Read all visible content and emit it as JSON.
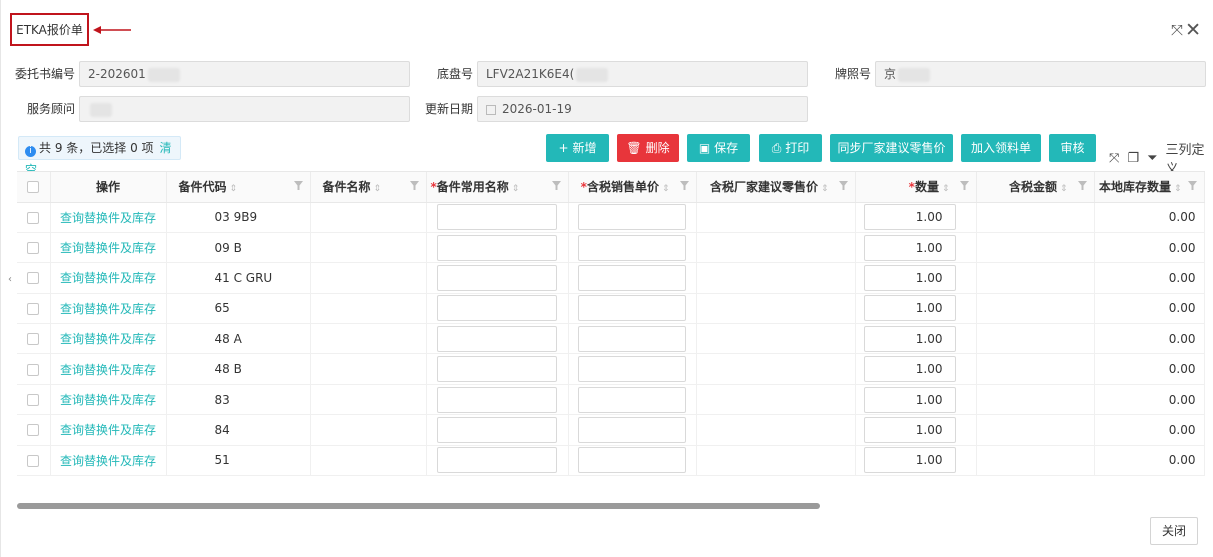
{
  "header": {
    "title": "ETKA报价单"
  },
  "form": {
    "entrust_no_label": "委托书编号",
    "entrust_no_value": "2-202601",
    "chassis_label": "底盘号",
    "chassis_value": "LFV2A21K6E4(",
    "plate_label": "牌照号",
    "plate_value": "京",
    "advisor_label": "服务顾问",
    "update_date_label": "更新日期",
    "update_date_value": "2026-01-19"
  },
  "toolbar": {
    "summary_prefix": "共 9 条，已选择 0 项",
    "clear_label": "清空",
    "add_label": "新增",
    "delete_label": "删除",
    "save_label": "保存",
    "print_label": "打印",
    "sync_label": "同步厂家建议零售价",
    "add_material_label": "加入领料单",
    "audit_label": "审核",
    "custom_cols_label": "三列定义"
  },
  "table": {
    "headers": {
      "op": "操作",
      "code": "备件代码",
      "name": "备件名称",
      "common_name": "备件常用名称",
      "tax_price": "含税销售单价",
      "retail_price": "含税厂家建议零售价",
      "qty": "数量",
      "amount": "含税金额",
      "stock": "本地库存数量"
    },
    "rows": [
      {
        "op": "查询替换件及库存",
        "code": "03 9B9",
        "qty": "1.00",
        "stock": "0.00"
      },
      {
        "op": "查询替换件及库存",
        "code": "09 B",
        "qty": "1.00",
        "stock": "0.00"
      },
      {
        "op": "查询替换件及库存",
        "code": "41 C GRU",
        "qty": "1.00",
        "stock": "0.00"
      },
      {
        "op": "查询替换件及库存",
        "code": "65",
        "qty": "1.00",
        "stock": "0.00"
      },
      {
        "op": "查询替换件及库存",
        "code": "48 A",
        "qty": "1.00",
        "stock": "0.00"
      },
      {
        "op": "查询替换件及库存",
        "code": "48 B",
        "qty": "1.00",
        "stock": "0.00"
      },
      {
        "op": "查询替换件及库存",
        "code": "83",
        "qty": "1.00",
        "stock": "0.00"
      },
      {
        "op": "查询替换件及库存",
        "code": "84",
        "qty": "1.00",
        "stock": "0.00"
      },
      {
        "op": "查询替换件及库存",
        "code": "51",
        "qty": "1.00",
        "stock": "0.00"
      }
    ]
  },
  "footer": {
    "close_label": "关闭"
  }
}
